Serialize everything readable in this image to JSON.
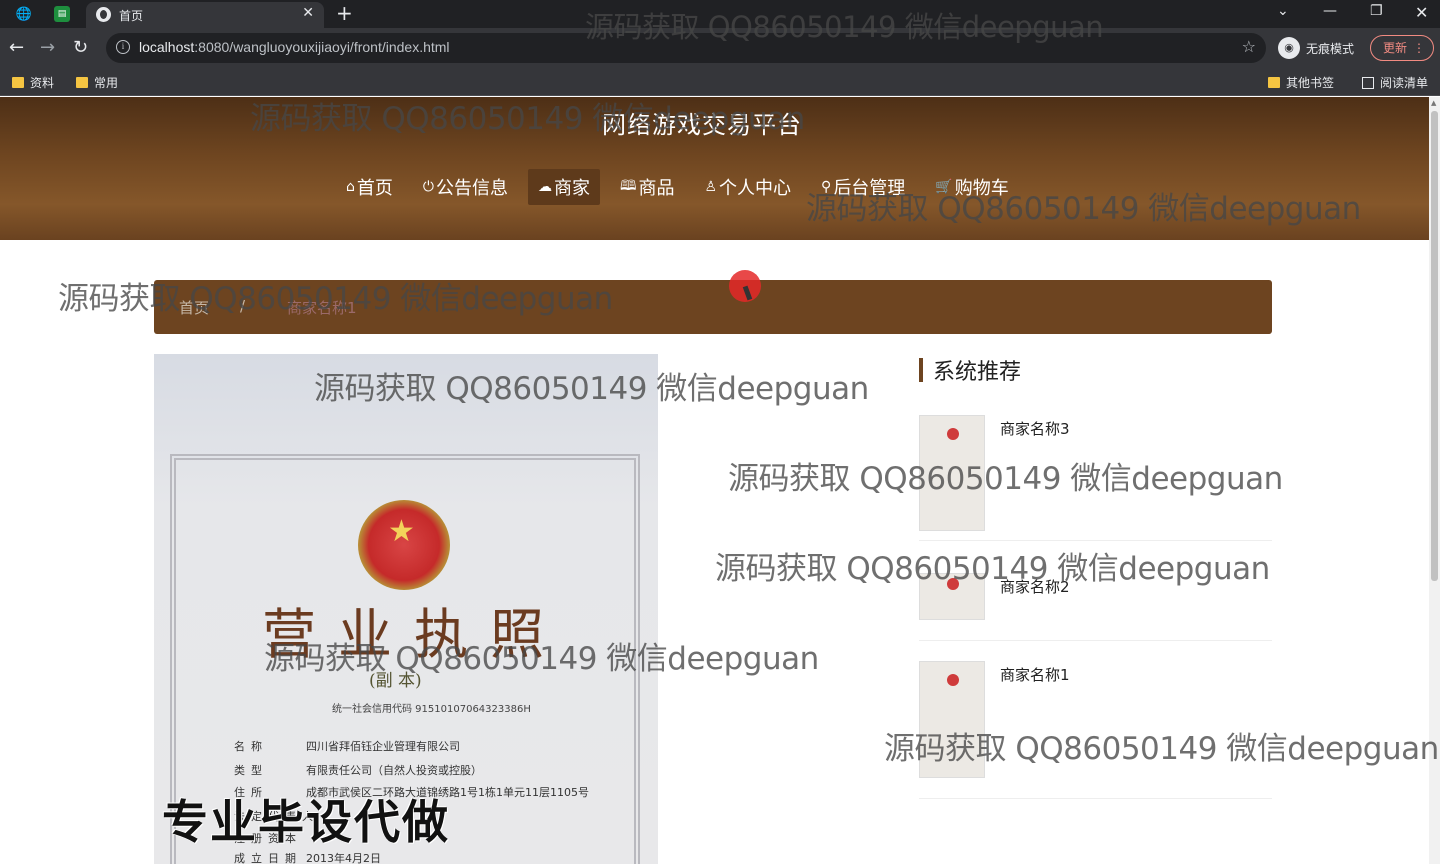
{
  "browser": {
    "tab_title": "首页",
    "url_host": "localhost",
    "url_rest": ":8080/wangluoyouxijiaoyi/front/index.html",
    "incognito_label": "无痕模式",
    "update_label": "更新",
    "bookmarks": [
      "资料",
      "常用"
    ],
    "other_bookmarks": "其他书签",
    "reading_list": "阅读清单"
  },
  "site": {
    "title": "网络游戏交易平台",
    "nav": [
      {
        "label": "首页",
        "icon": "home-icon",
        "glyph": "⌂"
      },
      {
        "label": "公告信息",
        "icon": "power-icon",
        "glyph": "⏻"
      },
      {
        "label": "商家",
        "icon": "cloud-icon",
        "glyph": "☁"
      },
      {
        "label": "商品",
        "icon": "book-icon",
        "glyph": "🕮"
      },
      {
        "label": "个人中心",
        "icon": "user-icon",
        "glyph": "♙"
      },
      {
        "label": "后台管理",
        "icon": "link-icon",
        "glyph": "⚲"
      },
      {
        "label": "购物车",
        "icon": "cart-icon",
        "glyph": "🛒"
      }
    ],
    "active_nav": "商家"
  },
  "breadcrumb": {
    "home": "首页",
    "separator": "/",
    "current": "商家名称1"
  },
  "certificate": {
    "title": "营业执照",
    "subtitle": "(副  本)",
    "credit_code": "统一社会信用代码 91510107064323386H",
    "rows": [
      {
        "k": "名称",
        "v": "四川省拜佰钰企业管理有限公司"
      },
      {
        "k": "类型",
        "v": "有限责任公司（自然人投资或控股）"
      },
      {
        "k": "住所",
        "v": "成都市武侯区二环路大道锦绣路1号1栋1单元11层1105号"
      },
      {
        "k": "法定代表人",
        "v": ""
      },
      {
        "k": "注册资本",
        "v": ""
      },
      {
        "k": "成立日期",
        "v": "2013年4月2日"
      }
    ],
    "overlay_text": "专业毕设代做"
  },
  "recommend": {
    "heading": "系统推荐",
    "items": [
      {
        "name": "商家名称3"
      },
      {
        "name": "商家名称2"
      },
      {
        "name": "商家名称1"
      }
    ]
  },
  "watermark": "源码获取 QQ86050149 微信deepguan",
  "colors": {
    "brand_brown": "#6d4420",
    "header_top": "#4d2f16",
    "header_mid": "#85572a"
  }
}
